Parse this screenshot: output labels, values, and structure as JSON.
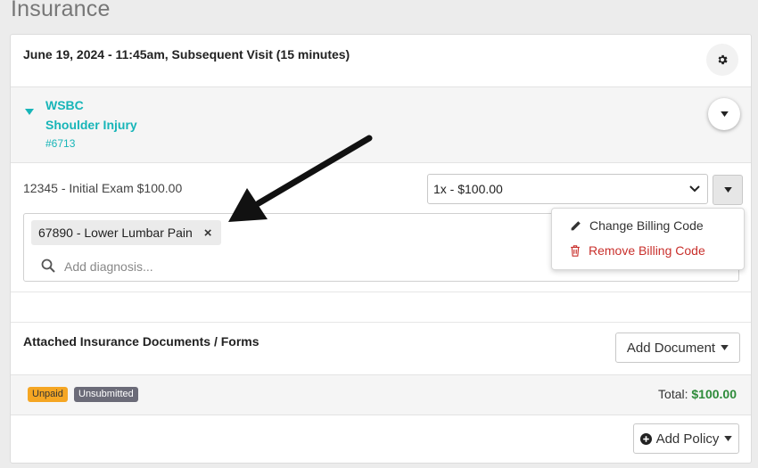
{
  "page": {
    "title": "Insurance"
  },
  "visit": {
    "title": "June 19, 2024 - 11:45am, Subsequent Visit (15 minutes)"
  },
  "policy": {
    "payer": "WSBC",
    "case_name": "Shoulder Injury",
    "case_number": "#6713"
  },
  "billing": {
    "code_line": "12345 - Initial Exam $100.00",
    "units_value": "1x - $100.00",
    "diagnosis_chip": "67890 - Lower Lumbar Pain",
    "chip_remove_glyph": "×",
    "diagnosis_placeholder": "Add diagnosis..."
  },
  "code_menu": {
    "change_label": "Change Billing Code",
    "remove_label": "Remove Billing Code"
  },
  "documents": {
    "title": "Attached Insurance Documents / Forms",
    "add_label": "Add Document"
  },
  "status": {
    "badges": [
      "Unpaid",
      "Unsubmitted"
    ],
    "total_label": "Total:",
    "total_amount": "$100.00"
  },
  "footer": {
    "add_policy_label": "Add Policy"
  },
  "colors": {
    "accent_teal": "#17b5b8",
    "danger": "#c9302c",
    "unpaid_badge": "#f5a623",
    "unsubmitted_badge": "#6b6b78",
    "total_green": "#2e8b3a"
  },
  "icons": [
    "gear-icon",
    "caret-down-icon",
    "search-icon",
    "pencil-icon",
    "trash-icon",
    "plus-circle-icon",
    "annotation-arrow"
  ]
}
